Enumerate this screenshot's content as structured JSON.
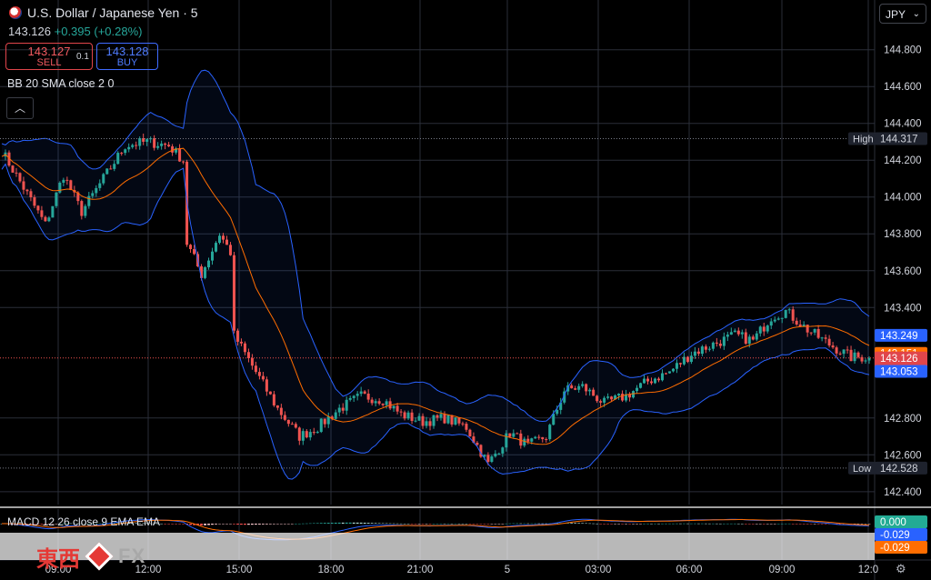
{
  "header": {
    "title": "U.S. Dollar / Japanese Yen · 5",
    "last_price": "143.126",
    "change": "+0.395 (+0.28%)",
    "sell_price": "143.127",
    "sell_label": "SELL",
    "buy_price": "143.128",
    "buy_label": "BUY",
    "spread": "0.1",
    "indicator": "BB 20 SMA close 2 0",
    "collapse_glyph": "︿",
    "currency": "JPY"
  },
  "macd": {
    "label": "MACD 12 26 close 9 EMA EMA"
  },
  "logo": {
    "cn": "東西",
    "fx": "FX"
  },
  "settings_glyph": "⚙",
  "colors": {
    "up": "#26a69a",
    "down": "#ef5350",
    "bb": "#2962ff",
    "basis": "#ff6d00",
    "grid": "#2a2e39"
  },
  "chart_data": [
    {
      "type": "candlestick",
      "title": "U.S. Dollar / Japanese Yen · 5",
      "y_ticks": [
        144.8,
        144.6,
        144.4,
        144.2,
        144.0,
        143.8,
        143.6,
        143.4,
        142.8,
        142.6,
        142.4
      ],
      "y_tick_labels": [
        "144.800",
        "144.600",
        "144.400",
        "144.200",
        "144.000",
        "143.800",
        "143.600",
        "143.400",
        "142.800",
        "142.600",
        "142.400"
      ],
      "ylim": [
        142.33,
        145.07
      ],
      "x_labels": [
        "09:00",
        "12:00",
        "15:00",
        "18:00",
        "21:00",
        "5",
        "03:00",
        "06:00",
        "09:00",
        "12:0"
      ],
      "price_path": [
        {
          "t": 0,
          "p": 144.25
        },
        {
          "t": 6,
          "p": 144.05
        },
        {
          "t": 12,
          "p": 143.85
        },
        {
          "t": 17,
          "p": 144.12
        },
        {
          "t": 22,
          "p": 143.92
        },
        {
          "t": 28,
          "p": 144.1
        },
        {
          "t": 34,
          "p": 144.28
        },
        {
          "t": 40,
          "p": 144.3
        },
        {
          "t": 46,
          "p": 144.28
        },
        {
          "t": 50,
          "p": 144.2
        },
        {
          "t": 51,
          "p": 143.75
        },
        {
          "t": 55,
          "p": 143.58
        },
        {
          "t": 60,
          "p": 143.8
        },
        {
          "t": 63,
          "p": 143.7
        },
        {
          "t": 64,
          "p": 143.25
        },
        {
          "t": 70,
          "p": 143.05
        },
        {
          "t": 76,
          "p": 142.85
        },
        {
          "t": 82,
          "p": 142.7
        },
        {
          "t": 87,
          "p": 142.75
        },
        {
          "t": 93,
          "p": 142.85
        },
        {
          "t": 99,
          "p": 142.92
        },
        {
          "t": 105,
          "p": 142.9
        },
        {
          "t": 110,
          "p": 142.82
        },
        {
          "t": 116,
          "p": 142.78
        },
        {
          "t": 122,
          "p": 142.8
        },
        {
          "t": 128,
          "p": 142.75
        },
        {
          "t": 134,
          "p": 142.55
        },
        {
          "t": 140,
          "p": 142.72
        },
        {
          "t": 145,
          "p": 142.65
        },
        {
          "t": 150,
          "p": 142.7
        },
        {
          "t": 155,
          "p": 142.95
        },
        {
          "t": 160,
          "p": 142.97
        },
        {
          "t": 166,
          "p": 142.88
        },
        {
          "t": 172,
          "p": 142.92
        },
        {
          "t": 178,
          "p": 143.0
        },
        {
          "t": 184,
          "p": 143.05
        },
        {
          "t": 190,
          "p": 143.15
        },
        {
          "t": 196,
          "p": 143.2
        },
        {
          "t": 202,
          "p": 143.25
        },
        {
          "t": 207,
          "p": 143.22
        },
        {
          "t": 212,
          "p": 143.35
        },
        {
          "t": 216,
          "p": 143.38
        },
        {
          "t": 222,
          "p": 143.28
        },
        {
          "t": 228,
          "p": 143.2
        },
        {
          "t": 234,
          "p": 143.13
        }
      ],
      "bollinger": {
        "basis_label": "143.151",
        "upper_label": "143.249",
        "lower_label": "143.053"
      },
      "markers": [
        {
          "label": "High",
          "value": 144.317,
          "text": "144.317"
        },
        {
          "label": "Low",
          "value": 142.528,
          "text": "142.528"
        }
      ],
      "current_price": {
        "value": 143.126,
        "text": "143.126",
        "countdown": "01:16"
      }
    },
    {
      "type": "bar",
      "title": "MACD 12 26 close 9 EMA EMA",
      "labels": [
        "0.000",
        "-0.029",
        "-0.029"
      ]
    }
  ]
}
